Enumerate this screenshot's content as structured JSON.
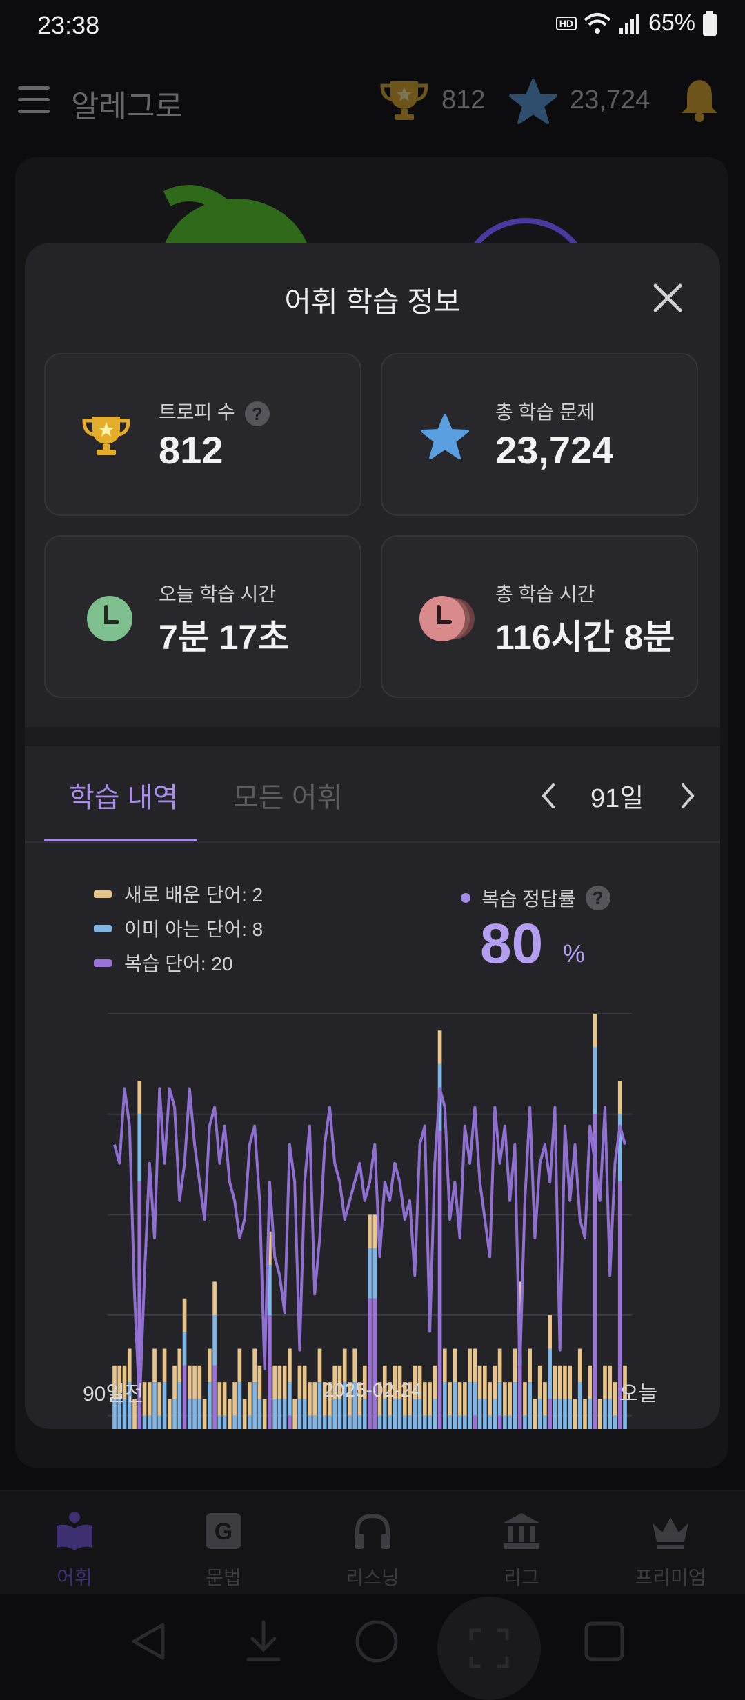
{
  "status": {
    "time": "23:38",
    "battery": "65%",
    "hd_voice": "HD Voice"
  },
  "header": {
    "title": "알레그로",
    "trophy_count": "812",
    "star_count": "23,724"
  },
  "modal": {
    "title": "어휘 학습 정보",
    "cards": {
      "trophies": {
        "label": "트로피 수",
        "value": "812",
        "help": "?"
      },
      "total_problems": {
        "label": "총 학습 문제",
        "value": "23,724"
      },
      "today_time": {
        "label": "오늘 학습 시간",
        "value": "7분 17초"
      },
      "total_time": {
        "label": "총 학습 시간",
        "value": "116시간 8분"
      }
    },
    "tabs": {
      "history": "학습 내역",
      "all_words": "모든 어휘"
    },
    "range": "91일",
    "legend": {
      "new_words": "새로 배운 단어: 2",
      "known_words": "이미 아는 단어: 8",
      "review_words": "복습 단어: 20"
    },
    "accuracy": {
      "label": "복습 정답률",
      "help": "?",
      "value": "80",
      "unit": "%"
    },
    "axis": {
      "start": "90일전",
      "mid": "2025-02-24",
      "end": "오늘"
    }
  },
  "nav": {
    "vocab": "어휘",
    "grammar": "문법",
    "listening": "리스닝",
    "league": "리그",
    "premium": "프리미엄"
  },
  "colors": {
    "accent": "#a48ae6",
    "new_words": "#e6c48a",
    "known_words": "#7fb6e6",
    "review_words": "#9a72d8",
    "trophy": "#e4ad2a",
    "star": "#5a9fe0",
    "today_clock": "#7fc08f",
    "total_clock": "#d98a8a"
  },
  "chart_data": {
    "type": "bar",
    "x_start": "90일전",
    "x_mid": "2025-02-24",
    "x_end": "오늘",
    "series": [
      {
        "name": "복습 단어",
        "values": [
          10,
          11,
          9,
          11,
          9,
          26,
          10,
          9,
          11,
          10,
          11,
          9,
          10,
          11,
          15,
          11,
          10,
          9,
          9,
          11,
          15,
          10,
          9,
          8,
          10,
          11,
          9,
          10,
          11,
          10,
          9,
          18,
          10,
          11,
          10,
          12,
          9,
          10,
          11,
          9,
          10,
          11,
          9,
          10,
          11,
          10,
          11,
          10,
          11,
          10,
          11,
          19,
          19,
          10,
          11,
          9,
          10,
          11,
          9,
          10,
          11,
          10,
          10,
          9,
          11,
          29,
          11,
          10,
          11,
          9,
          10,
          11,
          12,
          10,
          11,
          9,
          10,
          12,
          9,
          10,
          11,
          15,
          10,
          11,
          9,
          10,
          10,
          13,
          11,
          10,
          11,
          10,
          9,
          11,
          9,
          10,
          30,
          9,
          10,
          11,
          9,
          26,
          11
        ]
      },
      {
        "name": "이미 아는 단어",
        "values": [
          3,
          2,
          4,
          3,
          2,
          4,
          2,
          3,
          3,
          2,
          3,
          2,
          3,
          3,
          2,
          2,
          3,
          4,
          2,
          3,
          3,
          2,
          3,
          3,
          2,
          3,
          2,
          2,
          3,
          3,
          2,
          3,
          3,
          2,
          3,
          2,
          2,
          3,
          2,
          3,
          2,
          3,
          3,
          2,
          2,
          3,
          3,
          2,
          3,
          2,
          2,
          3,
          3,
          2,
          2,
          3,
          3,
          2,
          3,
          2,
          2,
          3,
          2,
          3,
          2,
          4,
          3,
          2,
          3,
          3,
          2,
          3,
          2,
          3,
          2,
          3,
          3,
          2,
          3,
          2,
          3,
          3,
          2,
          3,
          2,
          3,
          2,
          3,
          2,
          3,
          2,
          3,
          2,
          3,
          2,
          3,
          4,
          2,
          3,
          2,
          3,
          4,
          2
        ]
      },
      {
        "name": "새로 배운 단어",
        "values": [
          2,
          2,
          2,
          2,
          2,
          2,
          2,
          2,
          2,
          2,
          2,
          2,
          2,
          2,
          2,
          2,
          2,
          2,
          2,
          2,
          2,
          2,
          2,
          2,
          2,
          2,
          2,
          2,
          2,
          2,
          2,
          2,
          2,
          2,
          2,
          2,
          2,
          2,
          2,
          2,
          2,
          2,
          2,
          2,
          2,
          2,
          2,
          2,
          2,
          2,
          2,
          2,
          2,
          2,
          2,
          2,
          2,
          2,
          2,
          2,
          2,
          2,
          2,
          2,
          2,
          2,
          2,
          2,
          2,
          2,
          2,
          2,
          2,
          2,
          2,
          2,
          2,
          2,
          2,
          2,
          2,
          2,
          2,
          2,
          2,
          2,
          2,
          2,
          2,
          2,
          2,
          2,
          2,
          2,
          2,
          2,
          2,
          2,
          2,
          2,
          2,
          2,
          2
        ]
      },
      {
        "name": "복습 정답률",
        "values": [
          86,
          84,
          92,
          88,
          70,
          58,
          72,
          84,
          76,
          92,
          84,
          92,
          90,
          80,
          84,
          92,
          86,
          82,
          78,
          88,
          90,
          84,
          88,
          82,
          80,
          76,
          78,
          86,
          88,
          80,
          62,
          82,
          74,
          72,
          68,
          86,
          82,
          64,
          82,
          88,
          70,
          76,
          86,
          90,
          84,
          82,
          78,
          80,
          82,
          84,
          80,
          82,
          86,
          74,
          82,
          80,
          84,
          82,
          78,
          80,
          72,
          86,
          88,
          66,
          84,
          92,
          90,
          78,
          82,
          76,
          88,
          84,
          90,
          82,
          78,
          74,
          90,
          84,
          88,
          80,
          86,
          62,
          80,
          90,
          76,
          84,
          86,
          82,
          90,
          64,
          88,
          80,
          86,
          78,
          76,
          88,
          84,
          80,
          90,
          72,
          84,
          88,
          86
        ]
      }
    ]
  }
}
